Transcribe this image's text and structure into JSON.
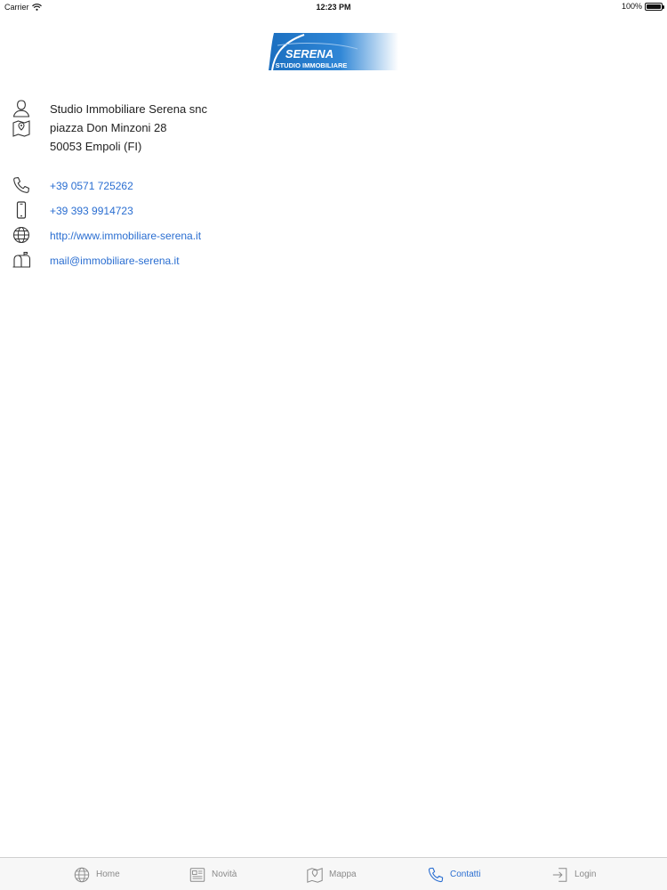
{
  "status_bar": {
    "carrier": "Carrier",
    "time": "12:23 PM",
    "battery": "100%"
  },
  "logo": {
    "line1": "SERENA",
    "line2": "STUDIO IMMOBILIARE"
  },
  "contact": {
    "name": "Studio Immobiliare Serena snc",
    "street": "piazza Don Minzoni 28",
    "city": "50053 Empoli (FI)",
    "phone": "+39 0571 725262",
    "mobile": "+39 393 9914723",
    "website": "http://www.immobiliare-serena.it",
    "email": "mail@immobiliare-serena.it"
  },
  "tabs": [
    {
      "label": "Home",
      "icon": "globe-icon",
      "active": false
    },
    {
      "label": "Novità",
      "icon": "newspaper-icon",
      "active": false
    },
    {
      "label": "Mappa",
      "icon": "map-icon",
      "active": false
    },
    {
      "label": "Contatti",
      "icon": "phone-icon",
      "active": true
    },
    {
      "label": "Login",
      "icon": "login-icon",
      "active": false
    }
  ],
  "colors": {
    "accent": "#2a6ed1",
    "logo_blue": "#1b6fc0",
    "inactive": "#8a8a8a"
  }
}
